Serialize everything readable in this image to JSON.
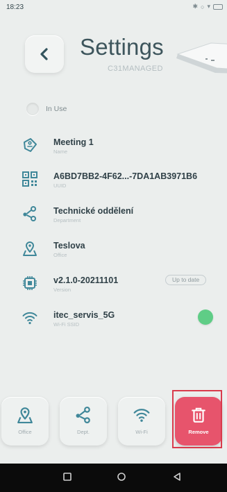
{
  "status_bar": {
    "time": "18:23"
  },
  "header": {
    "title": "Settings",
    "subtitle": "C31MANAGED"
  },
  "in_use": {
    "label": "In Use"
  },
  "rows": [
    {
      "value": "Meeting 1",
      "label": "Name",
      "icon": "tag-icon"
    },
    {
      "value": "A6BD7BB2-4F62...-7DA1AB3971B6",
      "label": "UUID",
      "icon": "qr-code-icon"
    },
    {
      "value": "Technické oddělení",
      "label": "Department",
      "icon": "network-icon"
    },
    {
      "value": "Teslova",
      "label": "Office",
      "icon": "location-icon"
    },
    {
      "value": "v2.1.0-20211101",
      "label": "Version",
      "icon": "chip-icon",
      "badge": "Up to date"
    },
    {
      "value": "itec_servis_5G",
      "label": "Wi-Fi SSID",
      "icon": "wifi-icon",
      "status_color": "#5fcd86"
    }
  ],
  "buttons": {
    "office": "Office",
    "dept": "Dept.",
    "wifi": "Wi-Fi",
    "remove": "Remove"
  },
  "colors": {
    "accent": "#3a8ea0",
    "remove": "#e7546c",
    "highlight": "#d93b4c"
  }
}
